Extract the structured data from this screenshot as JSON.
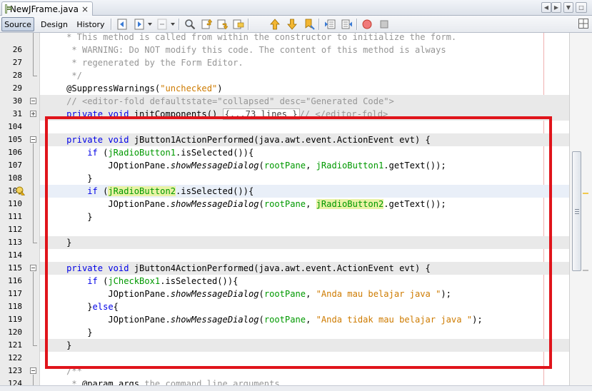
{
  "window": {
    "file_tab": "NewJFrame.java",
    "close_glyph": "×"
  },
  "toolbar": {
    "source": "Source",
    "design": "Design",
    "history": "History"
  },
  "icons": {
    "file_tab": "java-file-icon",
    "back": "back-navigation-icon",
    "forward": "forward-navigation-icon",
    "search": "find-icon",
    "prev_occurrence": "previous-occurrence-icon",
    "next_occurrence": "next-occurrence-icon",
    "toggle_highlight": "toggle-highlight-icon",
    "prev_bookmark": "previous-bookmark-icon",
    "next_bookmark": "next-bookmark-icon",
    "toggle_bookmark": "toggle-bookmark-icon",
    "shift_left": "shift-line-left-icon",
    "shift_right": "shift-line-right-icon",
    "record_macro": "start-macro-recording-icon",
    "stop_macro": "stop-macro-recording-icon",
    "split": "split-window-icon",
    "hint": "warning-hint-icon"
  },
  "colors": {
    "keyword": "#0000e6",
    "comment": "#969696",
    "string": "#ce7b00",
    "field": "#009900",
    "highlight_rect": "#e0141b",
    "current_line": "#e9eff8"
  },
  "lines": [
    {
      "num": "",
      "bg": "",
      "tokens": [
        {
          "t": "    ",
          "c": ""
        },
        {
          "t": "* This method is called from within the constructor to initialize the form.",
          "c": "cm"
        }
      ]
    },
    {
      "num": "26",
      "bg": "",
      "tokens": [
        {
          "t": "     * WARNING: Do NOT modify this code. The content of this method is always",
          "c": "cm"
        }
      ]
    },
    {
      "num": "27",
      "bg": "",
      "tokens": [
        {
          "t": "     * regenerated by the Form Editor.",
          "c": "cm"
        }
      ]
    },
    {
      "num": "28",
      "bg": "",
      "tokens": [
        {
          "t": "     */",
          "c": "cm"
        }
      ]
    },
    {
      "num": "29",
      "bg": "",
      "tokens": [
        {
          "t": "    @SuppressWarnings(",
          "c": ""
        },
        {
          "t": "\"unchecked\"",
          "c": "st"
        },
        {
          "t": ")",
          "c": ""
        }
      ]
    },
    {
      "num": "30",
      "bg": "gray",
      "tokens": [
        {
          "t": "    ",
          "c": ""
        },
        {
          "t": "// <editor-fold defaultstate=\"collapsed\" desc=\"Generated Code\">",
          "c": "cm"
        }
      ]
    },
    {
      "num": "31",
      "bg": "gray",
      "tokens": [
        {
          "t": "    ",
          "c": ""
        },
        {
          "t": "private",
          "c": "kw"
        },
        {
          "t": " ",
          "c": ""
        },
        {
          "t": "void",
          "c": "kw"
        },
        {
          "t": " initComponents() ",
          "c": ""
        },
        {
          "t": "{...73 lines }",
          "c": "pill"
        },
        {
          "t": "// </editor-fold>",
          "c": "cm"
        }
      ]
    },
    {
      "num": "104",
      "bg": "",
      "tokens": []
    },
    {
      "num": "105",
      "bg": "gray",
      "tokens": [
        {
          "t": "    ",
          "c": ""
        },
        {
          "t": "private",
          "c": "kw"
        },
        {
          "t": " ",
          "c": ""
        },
        {
          "t": "void",
          "c": "kw"
        },
        {
          "t": " jButton1ActionPerformed(java.awt.event.ActionEvent evt) {",
          "c": ""
        }
      ]
    },
    {
      "num": "106",
      "bg": "",
      "tokens": [
        {
          "t": "        ",
          "c": ""
        },
        {
          "t": "if",
          "c": "kw"
        },
        {
          "t": " (",
          "c": ""
        },
        {
          "t": "jRadioButton1",
          "c": "fld"
        },
        {
          "t": ".isSelected()){",
          "c": ""
        }
      ]
    },
    {
      "num": "107",
      "bg": "",
      "tokens": [
        {
          "t": "            JOptionPane.",
          "c": ""
        },
        {
          "t": "showMessageDialog",
          "c": "it"
        },
        {
          "t": "(",
          "c": ""
        },
        {
          "t": "rootPane",
          "c": "fld"
        },
        {
          "t": ", ",
          "c": ""
        },
        {
          "t": "jRadioButton1",
          "c": "fld"
        },
        {
          "t": ".getText());",
          "c": ""
        }
      ]
    },
    {
      "num": "108",
      "bg": "",
      "tokens": [
        {
          "t": "        }",
          "c": ""
        }
      ]
    },
    {
      "num": "109",
      "bg": "blue",
      "tokens": [
        {
          "t": "        ",
          "c": ""
        },
        {
          "t": "if",
          "c": "kw"
        },
        {
          "t": " (",
          "c": ""
        },
        {
          "t": "jRadioButton2",
          "c": "fld mark"
        },
        {
          "t": ".isSelected()){",
          "c": ""
        }
      ]
    },
    {
      "num": "110",
      "bg": "",
      "tokens": [
        {
          "t": "            JOptionPane.",
          "c": ""
        },
        {
          "t": "showMessageDialog",
          "c": "it"
        },
        {
          "t": "(",
          "c": ""
        },
        {
          "t": "rootPane",
          "c": "fld"
        },
        {
          "t": ", ",
          "c": ""
        },
        {
          "t": "jRadioButton2",
          "c": "fld mark"
        },
        {
          "t": ".getText());",
          "c": ""
        }
      ]
    },
    {
      "num": "111",
      "bg": "",
      "tokens": [
        {
          "t": "        }",
          "c": ""
        }
      ]
    },
    {
      "num": "112",
      "bg": "",
      "tokens": []
    },
    {
      "num": "113",
      "bg": "gray",
      "tokens": [
        {
          "t": "    }",
          "c": ""
        }
      ]
    },
    {
      "num": "114",
      "bg": "",
      "tokens": []
    },
    {
      "num": "115",
      "bg": "gray",
      "tokens": [
        {
          "t": "    ",
          "c": ""
        },
        {
          "t": "private",
          "c": "kw"
        },
        {
          "t": " ",
          "c": ""
        },
        {
          "t": "void",
          "c": "kw"
        },
        {
          "t": " jButton4ActionPerformed(java.awt.event.ActionEvent evt) {",
          "c": ""
        }
      ]
    },
    {
      "num": "116",
      "bg": "",
      "tokens": [
        {
          "t": "        ",
          "c": ""
        },
        {
          "t": "if",
          "c": "kw"
        },
        {
          "t": " (",
          "c": ""
        },
        {
          "t": "jCheckBox1",
          "c": "fld"
        },
        {
          "t": ".isSelected()){",
          "c": ""
        }
      ]
    },
    {
      "num": "117",
      "bg": "",
      "tokens": [
        {
          "t": "            JOptionPane.",
          "c": ""
        },
        {
          "t": "showMessageDialog",
          "c": "it"
        },
        {
          "t": "(",
          "c": ""
        },
        {
          "t": "rootPane",
          "c": "fld"
        },
        {
          "t": ", ",
          "c": ""
        },
        {
          "t": "\"Anda mau belajar java \"",
          "c": "st"
        },
        {
          "t": ");",
          "c": ""
        }
      ]
    },
    {
      "num": "118",
      "bg": "",
      "tokens": [
        {
          "t": "        }",
          "c": ""
        },
        {
          "t": "else",
          "c": "kw"
        },
        {
          "t": "{",
          "c": ""
        }
      ]
    },
    {
      "num": "119",
      "bg": "",
      "tokens": [
        {
          "t": "            JOptionPane.",
          "c": ""
        },
        {
          "t": "showMessageDialog",
          "c": "it"
        },
        {
          "t": "(",
          "c": ""
        },
        {
          "t": "rootPane",
          "c": "fld"
        },
        {
          "t": ", ",
          "c": ""
        },
        {
          "t": "\"Anda tidak mau belajar java \"",
          "c": "st"
        },
        {
          "t": ");",
          "c": ""
        }
      ]
    },
    {
      "num": "120",
      "bg": "",
      "tokens": [
        {
          "t": "        }",
          "c": ""
        }
      ]
    },
    {
      "num": "121",
      "bg": "gray",
      "tokens": [
        {
          "t": "    }",
          "c": ""
        }
      ]
    },
    {
      "num": "122",
      "bg": "",
      "tokens": []
    },
    {
      "num": "123",
      "bg": "",
      "tokens": [
        {
          "t": "    ",
          "c": ""
        },
        {
          "t": "/**",
          "c": "cm"
        }
      ]
    },
    {
      "num": "124",
      "bg": "",
      "tokens": [
        {
          "t": "     * ",
          "c": "cm"
        },
        {
          "t": "@param",
          "c": ""
        },
        {
          "t": " ",
          "c": "cm"
        },
        {
          "t": "args",
          "c": ""
        },
        {
          "t": " the command line arguments",
          "c": "cm"
        }
      ]
    }
  ]
}
